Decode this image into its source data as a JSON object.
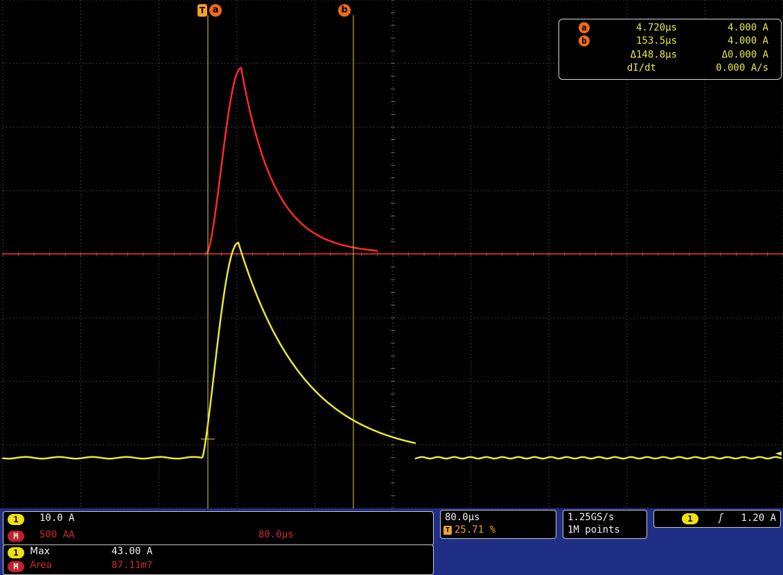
{
  "cursors": {
    "trigger_marker": "T",
    "a_label": "a",
    "b_label": "b"
  },
  "readout": {
    "a_time": "4.720µs",
    "a_value": "4.000 A",
    "b_time": "153.5µs",
    "b_value": "4.000 A",
    "delta_time": "Δ148.8µs",
    "delta_value": "Δ0.000 A",
    "rate_label": "dI/dt",
    "rate_value": "0.000 A/s"
  },
  "channel1": {
    "badge": "1",
    "scale": "10.0 A",
    "color": "#e8e83a",
    "ground_marker": "◄"
  },
  "math": {
    "badge": "M",
    "scale": "500 AA",
    "timebase": "80.0µs",
    "color": "#ff2a2a"
  },
  "horizontal": {
    "scale": "80.0µs",
    "trigger_pos": "25.71 %",
    "trigger_badge": "T"
  },
  "acquisition": {
    "sample_rate": "1.25GS/s",
    "record_length": "1M points"
  },
  "trigger": {
    "source_badge": "1",
    "slope_icon": "rising-edge-icon",
    "slope_glyph": "ʃ",
    "level": "1.20 A"
  },
  "measurements": [
    {
      "badge": "1",
      "name": "Max",
      "value": "43.00 A"
    },
    {
      "badge": "M",
      "name": "Area",
      "value": "87.11m?"
    }
  ],
  "colors": {
    "background": "#000000",
    "grid": "#6a6a6a",
    "panel": "#1f2f86",
    "cursor_line": "#e8d820",
    "cursor_tag": "#f26a17"
  }
}
